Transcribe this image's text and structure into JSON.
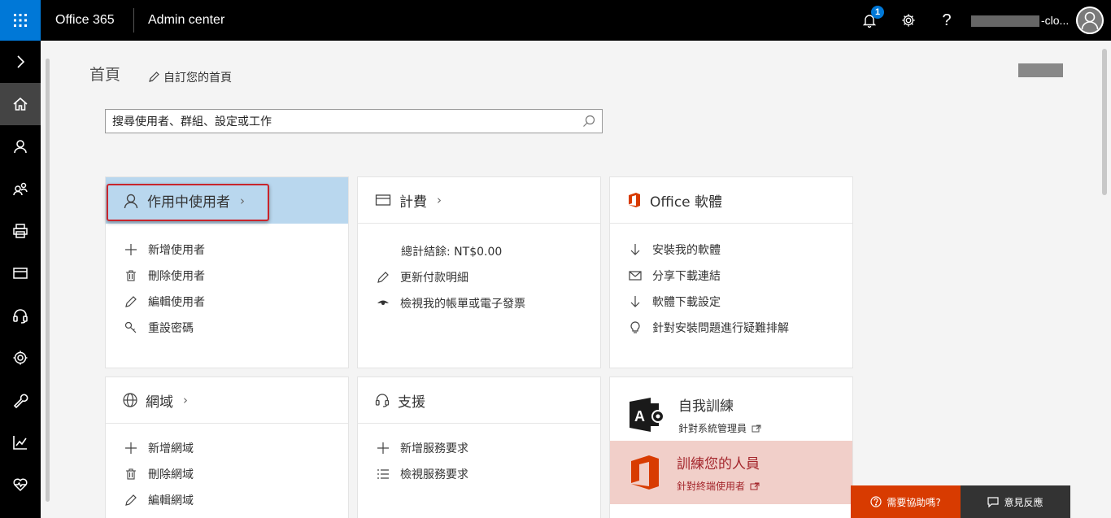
{
  "topbar": {
    "brand": "Office 365",
    "app": "Admin center",
    "notifications_count": "1",
    "account_suffix": "-clo..."
  },
  "header": {
    "title": "首頁",
    "customize": "自訂您的首頁"
  },
  "search": {
    "placeholder": "搜尋使用者、群組、設定或工作"
  },
  "cards": {
    "users": {
      "title": "作用中使用者",
      "items": [
        "新增使用者",
        "刪除使用者",
        "編輯使用者",
        "重設密碼"
      ]
    },
    "billing": {
      "title": "計費",
      "total": "總計結餘: NT$0.00",
      "items": [
        "更新付款明細",
        "檢視我的帳單或電子發票"
      ]
    },
    "office": {
      "title": "Office 軟體",
      "items": [
        "安裝我的軟體",
        "分享下載連結",
        "軟體下載設定",
        "針對安裝問題進行疑難排解"
      ]
    },
    "domains": {
      "title": "網域",
      "items": [
        "新增網域",
        "刪除網域",
        "編輯網域"
      ]
    },
    "support": {
      "title": "支援",
      "items": [
        "新增服務要求",
        "檢視服務要求"
      ]
    },
    "training": {
      "self_title": "自我訓練",
      "self_sub": "針對系統管理員",
      "people_title": "訓練您的人員",
      "people_sub": "針對終端使用者"
    }
  },
  "bottom": {
    "help": "需要協助嗎?",
    "feedback": "意見反應"
  },
  "colors": {
    "accent": "#0078d7",
    "active_card": "#b9d7ee",
    "training_highlight": "#f1cfc9",
    "help_button": "#d83b01",
    "highlight_box": "#c8252c"
  }
}
